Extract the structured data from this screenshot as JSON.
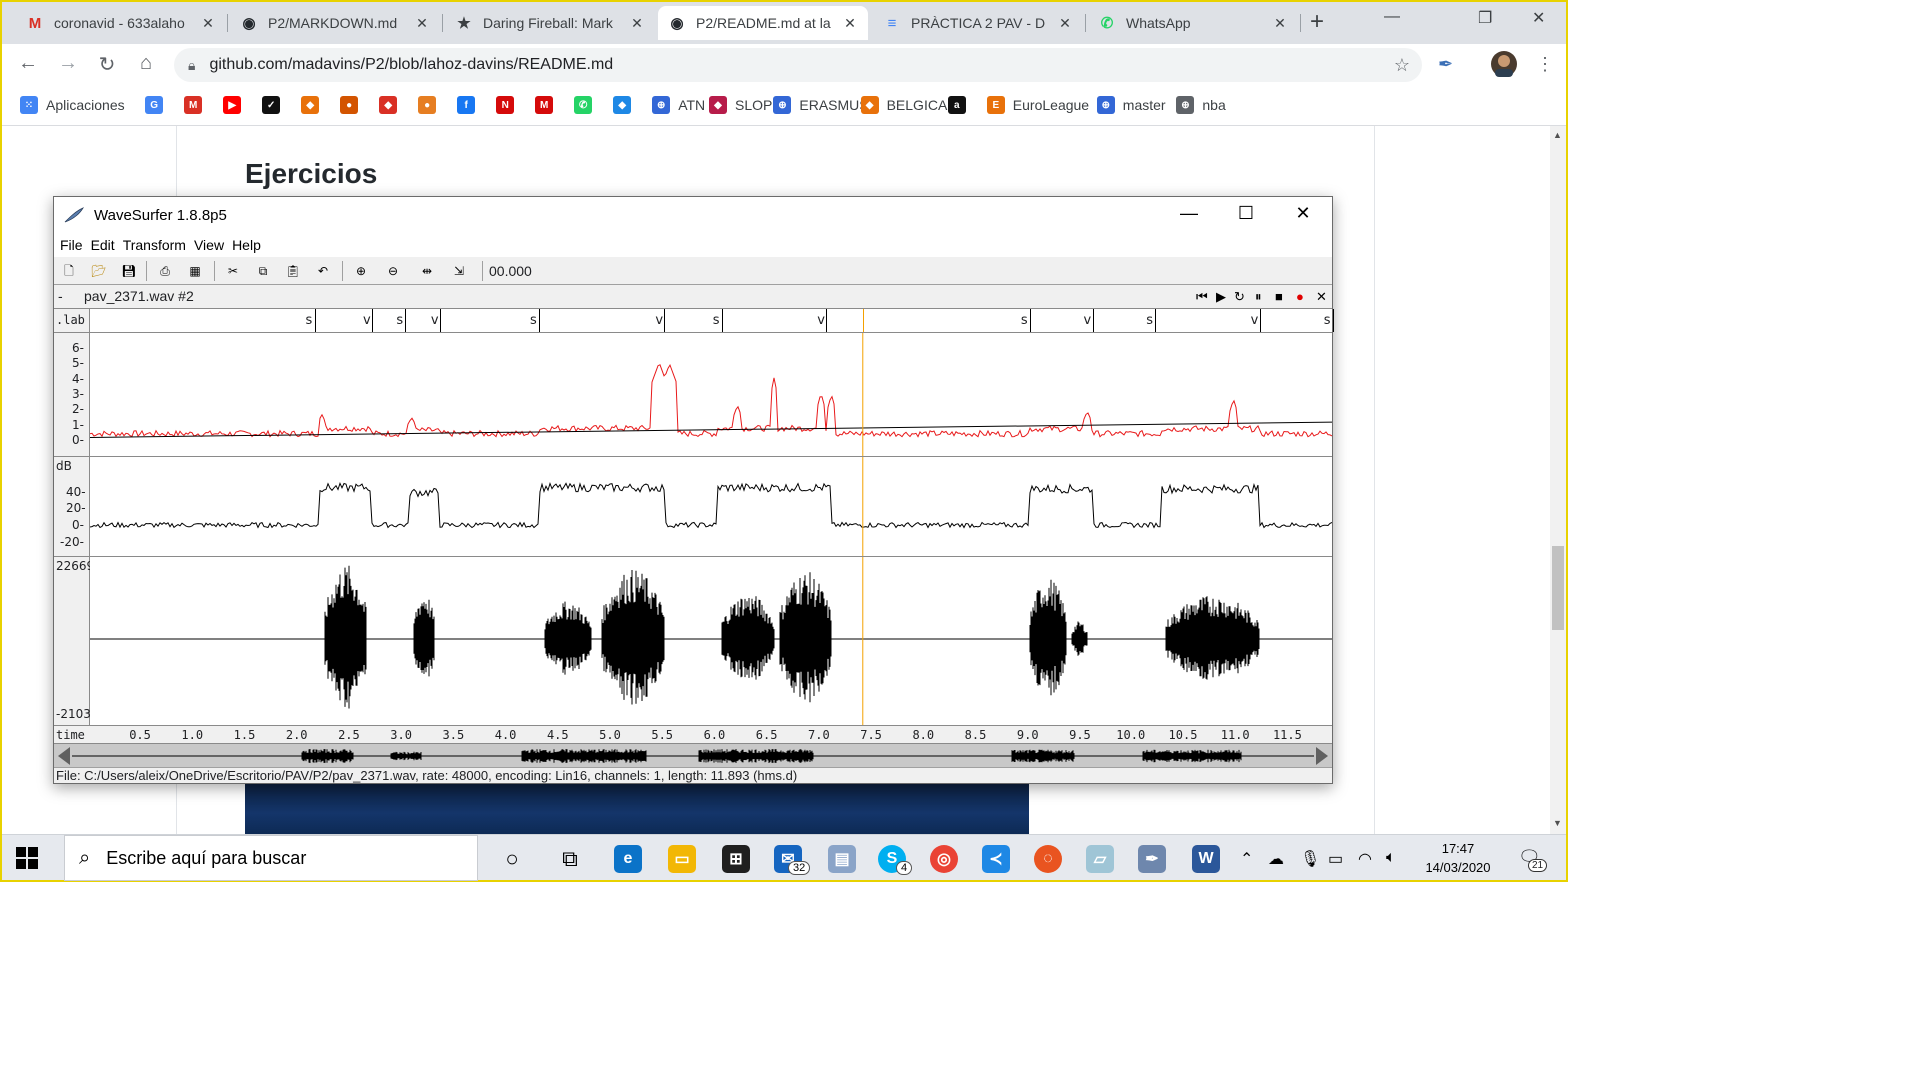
{
  "browser": {
    "tabs": [
      {
        "label": "coronavid - 633alaho",
        "icon": "gmail-icon",
        "glyph": "M",
        "color": "#d93025"
      },
      {
        "label": "P2/MARKDOWN.md",
        "icon": "github-icon",
        "glyph": "◉",
        "color": "#24292e"
      },
      {
        "label": "Daring Fireball: Mark",
        "icon": "star-icon",
        "glyph": "★",
        "color": "#3c4043"
      },
      {
        "label": "P2/README.md at la",
        "icon": "github-icon",
        "glyph": "◉",
        "color": "#24292e"
      },
      {
        "label": "PRÀCTICA 2 PAV - D",
        "icon": "google-docs-icon",
        "glyph": "≡",
        "color": "#4285f4"
      },
      {
        "label": "WhatsApp",
        "icon": "whatsapp-icon",
        "glyph": "✆",
        "color": "#25d366"
      }
    ],
    "url": "github.com/madavins/P2/blob/lahoz-davins/README.md",
    "bookmarks": [
      {
        "label": "Aplicaciones",
        "icon": "apps-grid-icon",
        "color": "#4285f4"
      },
      {
        "label": "",
        "icon": "google-icon",
        "color": "#4285f4"
      },
      {
        "label": "",
        "icon": "gmail-icon",
        "color": "#d93025"
      },
      {
        "label": "",
        "icon": "youtube-icon",
        "color": "#ff0000"
      },
      {
        "label": "",
        "icon": "nike-icon",
        "color": "#111111"
      },
      {
        "label": "",
        "icon": "bookmark-icon",
        "color": "#e8710a"
      },
      {
        "label": "",
        "icon": "basketball-icon",
        "color": "#d35400"
      },
      {
        "label": "",
        "icon": "bookmark-icon",
        "color": "#d93025"
      },
      {
        "label": "",
        "icon": "basketball-icon",
        "color": "#e67e22"
      },
      {
        "label": "",
        "icon": "facebook-icon",
        "color": "#1877f2"
      },
      {
        "label": "",
        "icon": "nfl-icon",
        "color": "#d50a0a"
      },
      {
        "label": "",
        "icon": "marca-icon",
        "color": "#d50a0a"
      },
      {
        "label": "",
        "icon": "whatsapp-icon",
        "color": "#25d366"
      },
      {
        "label": "",
        "icon": "bookmark-icon",
        "color": "#1e88e5"
      },
      {
        "label": "ATN",
        "icon": "globe-icon",
        "color": "#3367d6"
      },
      {
        "label": "SLOP",
        "icon": "diamond-icon",
        "color": "#b71c4a"
      },
      {
        "label": "ERASMUS",
        "icon": "globe-icon",
        "color": "#3367d6"
      },
      {
        "label": "BELGICA",
        "icon": "bookmark-icon",
        "color": "#e8710a"
      },
      {
        "label": "",
        "icon": "amazon-icon",
        "color": "#111111"
      },
      {
        "label": "EuroLeague",
        "icon": "euroleague-icon",
        "color": "#e8710a"
      },
      {
        "label": "master",
        "icon": "globe-icon",
        "color": "#3367d6"
      },
      {
        "label": "nba",
        "icon": "globe-icon",
        "color": "#5f6368"
      }
    ]
  },
  "page": {
    "heading": "Ejercicios"
  },
  "wavesurfer": {
    "title": "WaveSurfer 1.8.8p5",
    "menu": [
      "File",
      "Edit",
      "Transform",
      "View",
      "Help"
    ],
    "time_field": "00.000",
    "file_dash": "-",
    "file_name": "pav_2371.wav #2",
    "lab_axis": ".lab",
    "segments": [
      {
        "t": 2.15,
        "label": "s"
      },
      {
        "t": 2.7,
        "label": "v"
      },
      {
        "t": 3.02,
        "label": "s"
      },
      {
        "t": 3.35,
        "label": "v"
      },
      {
        "t": 4.3,
        "label": "s"
      },
      {
        "t": 5.5,
        "label": "v"
      },
      {
        "t": 6.05,
        "label": "s"
      },
      {
        "t": 7.05,
        "label": "v"
      },
      {
        "t": 9.0,
        "label": "s"
      },
      {
        "t": 9.6,
        "label": "v"
      },
      {
        "t": 10.2,
        "label": "s"
      },
      {
        "t": 11.2,
        "label": "v"
      },
      {
        "t": 11.9,
        "label": "s"
      }
    ],
    "pane1_ticks": [
      "6-",
      "5-",
      "4-",
      "3-",
      "2-",
      "1-",
      "0-"
    ],
    "pane2_unit": "dB",
    "pane2_ticks": [
      "40-",
      "20-",
      "0-",
      "-20-"
    ],
    "wave_max": "22669",
    "wave_min": "-2103",
    "time_axis_name": "time",
    "time_ticks": [
      "0.5",
      "1.0",
      "1.5",
      "2.0",
      "2.5",
      "3.0",
      "3.5",
      "4.0",
      "4.5",
      "5.0",
      "5.5",
      "6.0",
      "6.5",
      "7.0",
      "7.5",
      "8.0",
      "8.5",
      "9.0",
      "9.5",
      "10.0",
      "10.5",
      "11.0",
      "11.5"
    ],
    "cursor_time": 7.4,
    "duration": 11.893,
    "status": "File: C:/Users/aleix/OneDrive/Escritorio/PAV/P2/pav_2371.wav, rate: 48000, encoding: Lin16, channels: 1, length: 11.893 (hms.d)",
    "colors": {
      "pitch": "#e8191a",
      "cursor": "#f4a000",
      "wave": "#000000"
    }
  },
  "taskbar": {
    "search_placeholder": "Escribe aquí para buscar",
    "mail_badge": "32",
    "skype_badge": "4",
    "time": "17:47",
    "date": "14/03/2020",
    "notif_badge": "21"
  }
}
